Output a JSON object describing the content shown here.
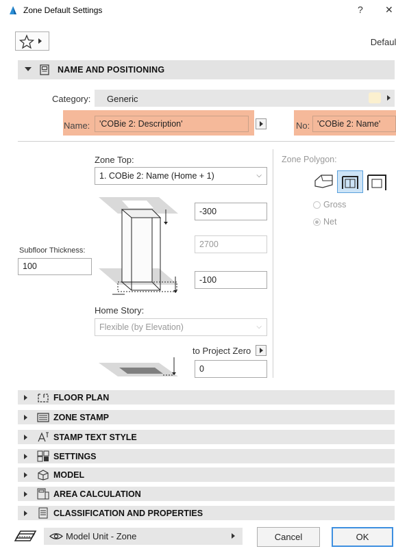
{
  "window": {
    "title": "Zone Default Settings",
    "help_label": "?",
    "close_label": "✕"
  },
  "toolbar": {
    "favorites_icon": "star-icon",
    "default_label": "Default"
  },
  "name_section": {
    "title": "NAME AND POSITIONING",
    "category_label": "Category:",
    "category_value": "Generic",
    "name_label": "Name:",
    "name_value": "'COBie 2: Description'",
    "no_label": "No:",
    "no_value": "'COBie 2: Name'",
    "highlight_color": "#f5b99a"
  },
  "zone_top": {
    "label": "Zone Top:",
    "value": "1. COBie 2: Name (Home + 1)"
  },
  "offsets": {
    "top_offset": "-300",
    "height": "2700",
    "bottom_offset": "-100"
  },
  "subfloor": {
    "label": "Subfloor Thickness:",
    "value": "100"
  },
  "home_story": {
    "label": "Home Story:",
    "value": "Flexible (by Elevation)"
  },
  "project_zero": {
    "label": "to Project Zero",
    "value": "0"
  },
  "zone_polygon": {
    "label": "Zone Polygon:",
    "options": [
      "Gross",
      "Net"
    ],
    "selected": "Net"
  },
  "sections": [
    {
      "title": "FLOOR PLAN",
      "icon": "floor-plan-icon"
    },
    {
      "title": "ZONE STAMP",
      "icon": "zone-stamp-icon"
    },
    {
      "title": "STAMP TEXT STYLE",
      "icon": "text-style-icon"
    },
    {
      "title": "SETTINGS",
      "icon": "settings-grid-icon"
    },
    {
      "title": "MODEL",
      "icon": "model-cube-icon"
    },
    {
      "title": "AREA CALCULATION",
      "icon": "area-calculation-icon"
    },
    {
      "title": "CLASSIFICATION AND PROPERTIES",
      "icon": "classification-icon"
    }
  ],
  "footer": {
    "view_value": "Model Unit - Zone",
    "cancel_label": "Cancel",
    "ok_label": "OK",
    "accent_color": "#3d8fe0"
  }
}
